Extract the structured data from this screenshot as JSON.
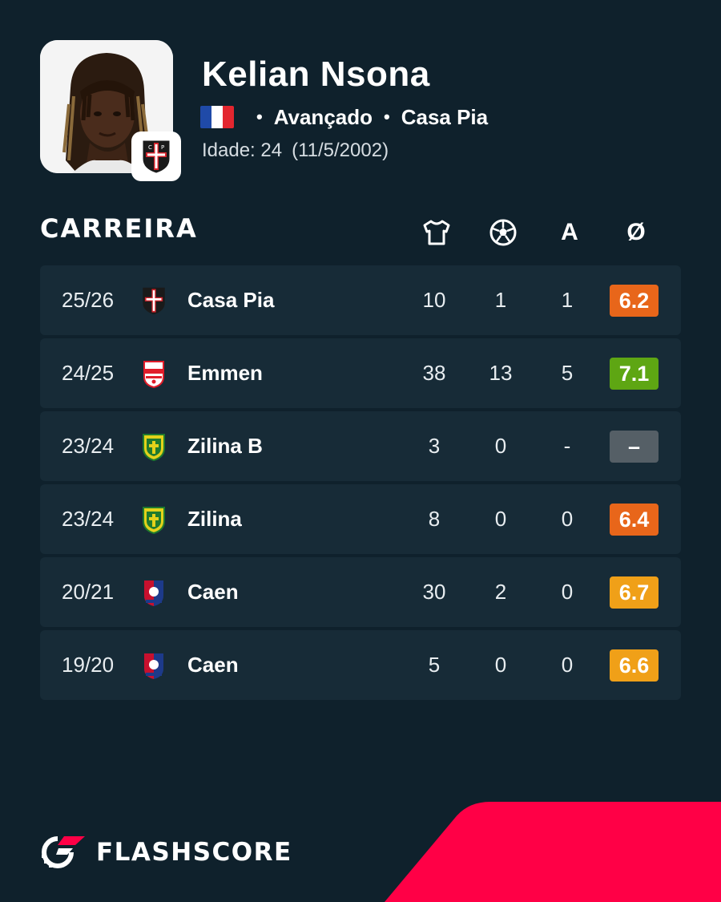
{
  "player": {
    "name": "Kelian Nsona",
    "position": "Avançado",
    "club": "Casa Pia",
    "age_label": "Idade: 24",
    "birth_date": "(11/5/2002)",
    "flag_colors": [
      "#1f4aa8",
      "#ffffff",
      "#e3262f"
    ]
  },
  "career": {
    "title": "CARREIRA",
    "columns": {
      "apps_icon": "shirt-icon",
      "goals_icon": "football-icon",
      "assists": "A",
      "rating": "Ø"
    },
    "rows": [
      {
        "season": "25/26",
        "team": "Casa Pia",
        "logo": "casa-pia-logo",
        "apps": "10",
        "goals": "1",
        "assists": "1",
        "rating": "6.2",
        "rating_color": "#e8661a"
      },
      {
        "season": "24/25",
        "team": "Emmen",
        "logo": "emmen-logo",
        "apps": "38",
        "goals": "13",
        "assists": "5",
        "rating": "7.1",
        "rating_color": "#5ea613"
      },
      {
        "season": "23/24",
        "team": "Zilina B",
        "logo": "zilina-logo",
        "apps": "3",
        "goals": "0",
        "assists": "-",
        "rating": "–",
        "rating_color": "#555f66"
      },
      {
        "season": "23/24",
        "team": "Zilina",
        "logo": "zilina-logo",
        "apps": "8",
        "goals": "0",
        "assists": "0",
        "rating": "6.4",
        "rating_color": "#e8661a"
      },
      {
        "season": "20/21",
        "team": "Caen",
        "logo": "caen-logo",
        "apps": "30",
        "goals": "2",
        "assists": "0",
        "rating": "6.7",
        "rating_color": "#f0a018"
      },
      {
        "season": "19/20",
        "team": "Caen",
        "logo": "caen-logo",
        "apps": "5",
        "goals": "0",
        "assists": "0",
        "rating": "6.6",
        "rating_color": "#f0a018"
      }
    ]
  },
  "brand": {
    "name": "FLASHSCORE",
    "accent": "#ff0046"
  }
}
